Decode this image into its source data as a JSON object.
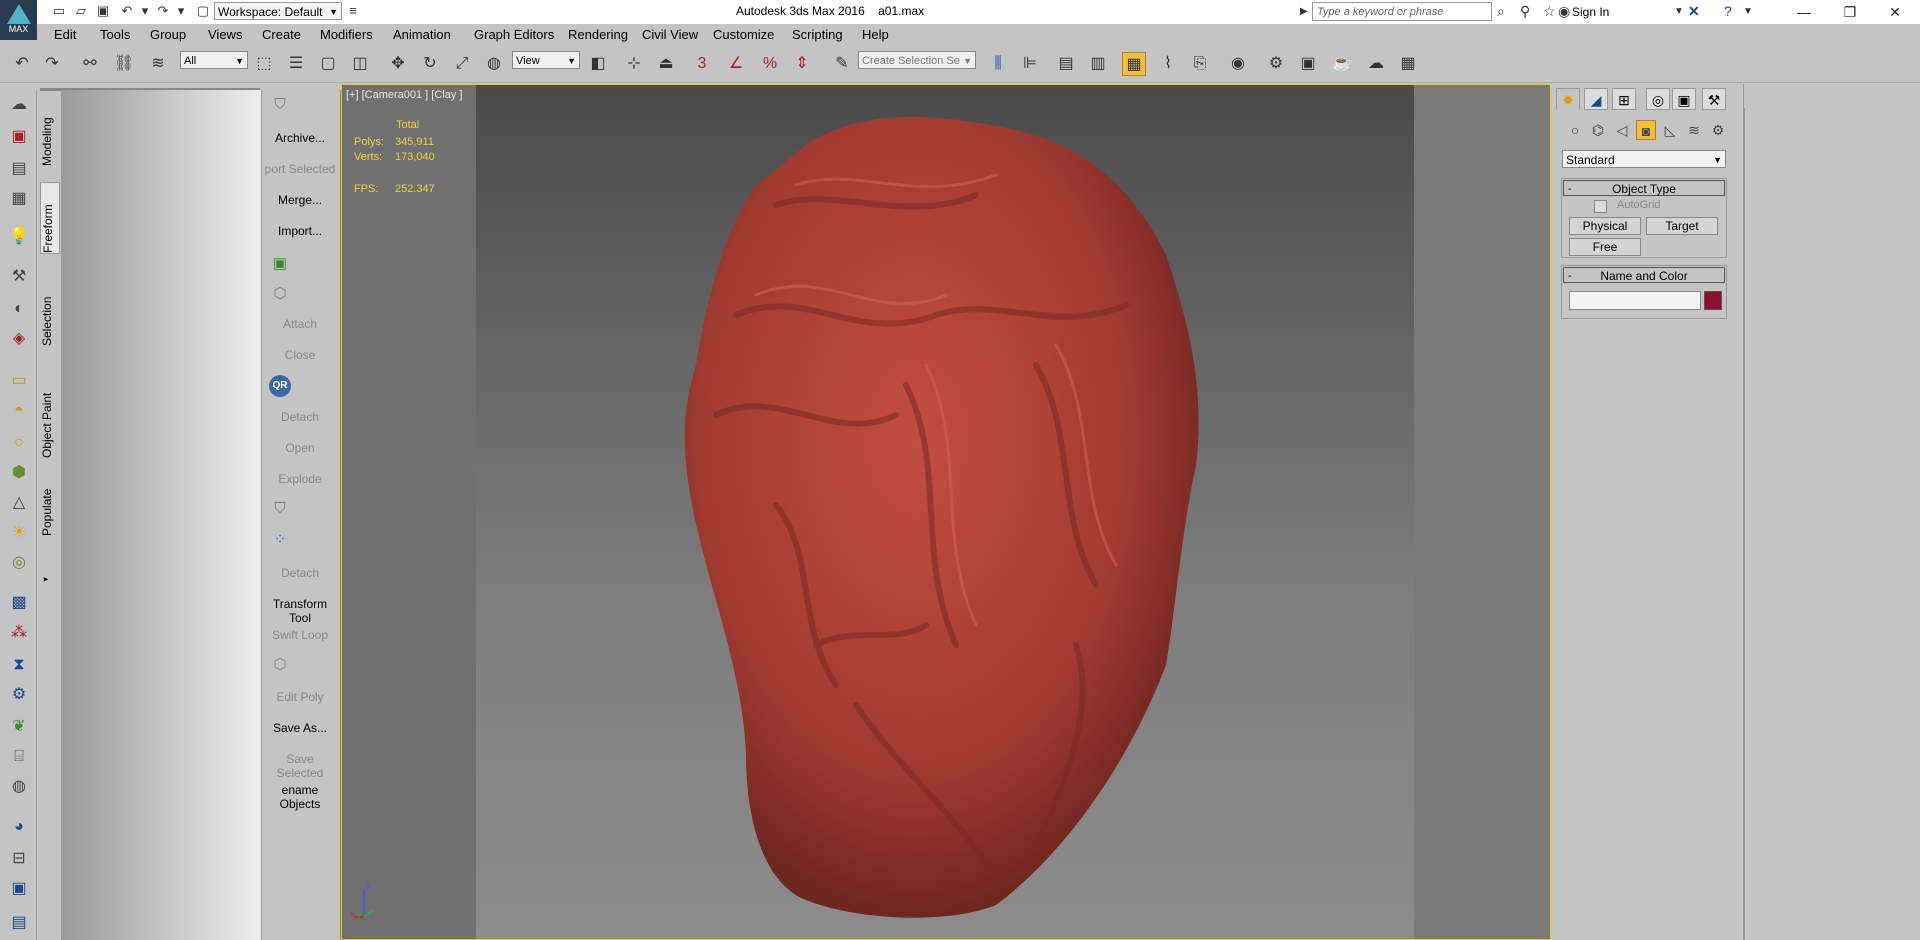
{
  "titlebar": {
    "workspace": "Workspace: Default",
    "app_title": "Autodesk 3ds Max 2016",
    "file_name": "a01.max",
    "search_placeholder": "Type a keyword or phrase",
    "sign_in": "Sign In",
    "logo_text": "MAX"
  },
  "menu": [
    "Edit",
    "Tools",
    "Group",
    "Views",
    "Create",
    "Modifiers",
    "Animation",
    "Graph Editors",
    "Rendering",
    "Civil View",
    "Customize",
    "Scripting",
    "Help"
  ],
  "toolbar": {
    "filter": "All",
    "ref_coord": "View",
    "selection_set_placeholder": "Create Selection Se",
    "snap_label": "3",
    "angle_label": "%"
  },
  "ribbon_tabs": [
    "Modeling",
    "Freeform",
    "Selection",
    "Object Paint",
    "Populate"
  ],
  "tools_panel": [
    {
      "label": "Archive...",
      "enabled": true
    },
    {
      "label": "port Selected",
      "enabled": false
    },
    {
      "label": "Merge...",
      "enabled": true
    },
    {
      "label": "Import...",
      "enabled": true
    },
    {
      "label": "Attach",
      "enabled": false
    },
    {
      "label": "Close",
      "enabled": false
    },
    {
      "label": "Detach",
      "enabled": false
    },
    {
      "label": "Open",
      "enabled": false
    },
    {
      "label": "Explode",
      "enabled": false
    },
    {
      "label": "Detach",
      "enabled": false
    },
    {
      "label": "Transform Tool",
      "enabled": true
    },
    {
      "label": "Swift Loop",
      "enabled": false
    },
    {
      "label": "Edit Poly",
      "enabled": false
    },
    {
      "label": "Save As...",
      "enabled": true
    },
    {
      "label": "Save Selected",
      "enabled": false
    },
    {
      "label": "ename Objects",
      "enabled": true
    }
  ],
  "qr_label": "QR",
  "viewport": {
    "label": "[+] [Camera001 ] [Clay ]",
    "stats_header": "Total",
    "polys_label": "Polys:",
    "polys_value": "345,911",
    "verts_label": "Verts:",
    "verts_value": "173,040",
    "fps_label": "FPS:",
    "fps_value": "252.347",
    "axis_z": "z",
    "axis_x": "x",
    "axis_y": "y"
  },
  "command_panel": {
    "category": "Standard",
    "object_type_title": "Object Type",
    "autogrid": "AutoGrid",
    "buttons": [
      "Physical",
      "Target",
      "Free"
    ],
    "name_color_title": "Name and Color",
    "object_color": "#8a1030"
  },
  "colors": {
    "viewport_border": "#e8d000",
    "stats": "#f0d040",
    "clay": "#b0453a"
  }
}
